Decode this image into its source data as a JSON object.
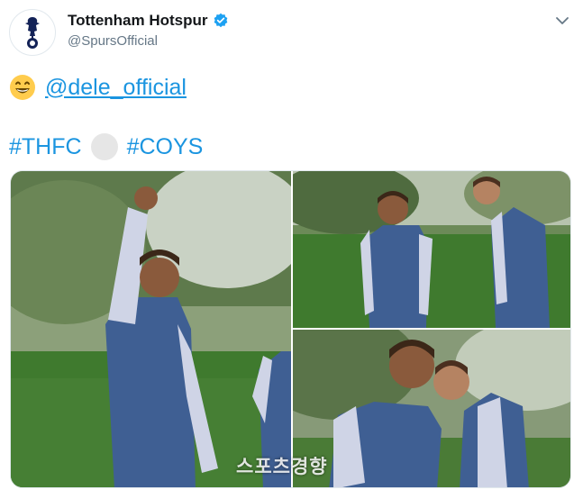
{
  "account": {
    "name": "Tottenham Hotspur",
    "handle": "@SpursOfficial"
  },
  "tweet": {
    "mention": "@dele_official",
    "hashtags": [
      "#THFC",
      "#COYS"
    ]
  },
  "photos": [
    "player celebrating with raised fist",
    "two players on training pitch",
    "two players smiling"
  ],
  "watermark": "스포츠경향",
  "colors": {
    "link": "#1b95e0",
    "verified": "#1da1f2",
    "kit": "#3f5f93",
    "grass": "#3f7a2e"
  }
}
